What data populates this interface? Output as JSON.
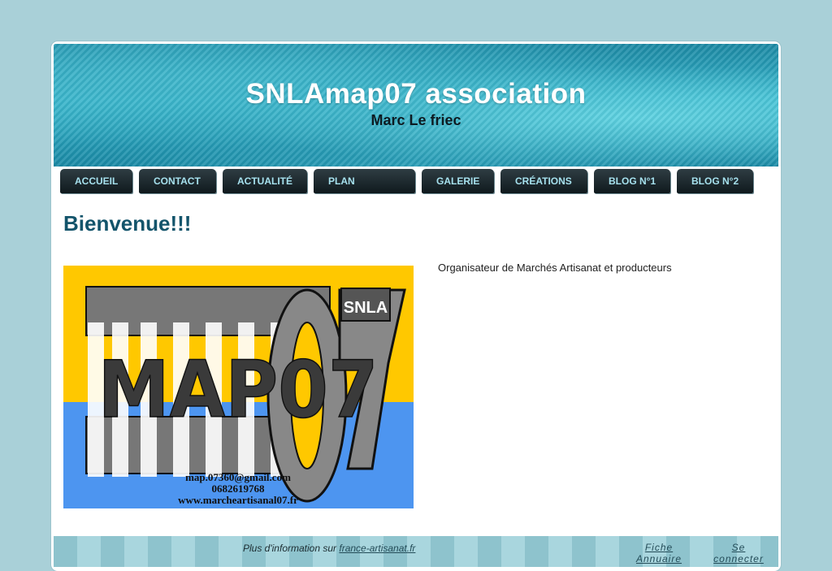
{
  "header": {
    "title": "SNLAmap07 association",
    "subtitle": "Marc Le friec"
  },
  "nav": {
    "items": [
      {
        "label": "ACCUEIL"
      },
      {
        "label": "CONTACT"
      },
      {
        "label": "ACTUALITÉ"
      },
      {
        "label": "PLAN"
      },
      {
        "label": "GALERIE"
      },
      {
        "label": "CRÉATIONS"
      },
      {
        "label": "BLOG N°1"
      },
      {
        "label": "BLOG N°2"
      }
    ]
  },
  "main": {
    "heading": "Bienvenue!!!",
    "intro": "Organisateur de Marchés Artisanat et producteurs",
    "logo": {
      "badge": "SNLA",
      "wordmark": "MAP07",
      "email": "map.07360@gmail.com",
      "phone": "0682619768",
      "website": "www.marcheartisanal07.fr"
    }
  },
  "footer": {
    "info_prefix": "Plus d'information sur",
    "info_link": "france-artisanat.fr",
    "fiche_line1": "Fiche",
    "fiche_line2": "Annuaire",
    "login_line1": "Se",
    "login_line2": "connecter"
  },
  "colors": {
    "background": "#a9d0d8",
    "nav_text": "#a6e1ee",
    "heading": "#13546b",
    "logo_yellow": "#ffc800",
    "logo_blue": "#4d95f0"
  }
}
